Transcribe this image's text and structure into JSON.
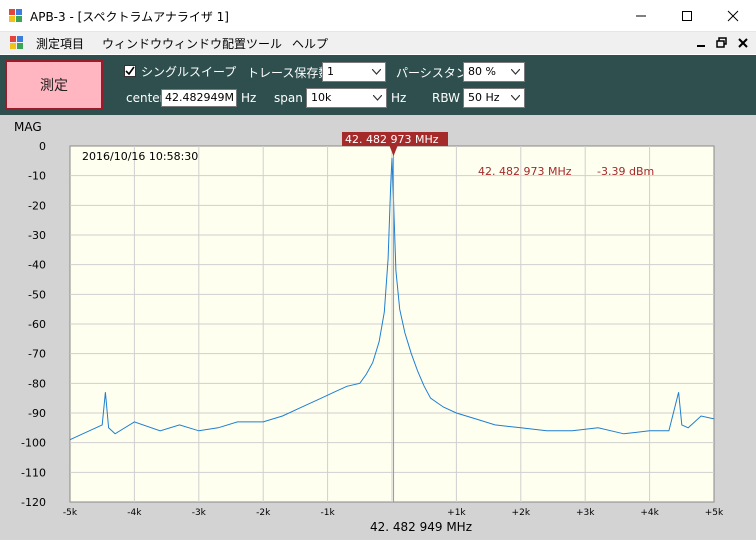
{
  "window": {
    "title": "APB-3 - [スペクトラムアナライザ 1]"
  },
  "menu": {
    "items": [
      "測定項目",
      "ウィンドウ",
      "ウィンドウ配置",
      "ツール",
      "ヘルプ"
    ]
  },
  "toolbar": {
    "measure_label": "測定",
    "single_sweep_label": "シングルスイープ",
    "single_sweep_checked": true,
    "trace_save_label": "トレース保存数",
    "trace_save_value": "1",
    "persistence_label": "パーシスタンス",
    "persistence_value": "80 %",
    "center_label": "center",
    "center_value": "42.482949M",
    "center_unit": "Hz",
    "span_label": "span",
    "span_value": "10k",
    "span_unit": "Hz",
    "rbw_label": "RBW",
    "rbw_value": "50 Hz"
  },
  "plot": {
    "mag_label": "MAG",
    "timestamp": "2016/10/16 10:58:30",
    "marker_label": "42. 482 973 MHz",
    "marker_freq_readout": "42. 482 973 MHz",
    "marker_level_readout": "-3.39 dBm",
    "center_freq_label": "42. 482 949 MHz",
    "background_color": "#fffff0",
    "trace_color": "#1e7fd0",
    "marker_color": "#a52a2a"
  },
  "chart_data": {
    "type": "line",
    "x_ticks": [
      "-5k",
      "-4k",
      "-3k",
      "-2k",
      "-1k",
      "0",
      "+1k",
      "+2k",
      "+3k",
      "+4k",
      "+5k"
    ],
    "y_ticks": [
      "0",
      "-10",
      "-20",
      "-30",
      "-40",
      "-50",
      "-60",
      "-70",
      "-80",
      "-90",
      "-100",
      "-110",
      "-120"
    ],
    "xlim": [
      -5000,
      5000
    ],
    "ylim": [
      -120,
      0
    ],
    "grid": true,
    "series": [
      {
        "x": [
          -5000,
          -4700,
          -4500,
          -4450,
          -4400,
          -4300,
          -4000,
          -3600,
          -3300,
          -3000,
          -2700,
          -2400,
          -2000,
          -1700,
          -1400,
          -1100,
          -900,
          -700,
          -500,
          -400,
          -300,
          -200,
          -120,
          -60,
          -20,
          0,
          20,
          60,
          120,
          200,
          300,
          400,
          500,
          600,
          800,
          1000,
          1300,
          1600,
          2000,
          2400,
          2800,
          3200,
          3600,
          4000,
          4300,
          4450,
          4500,
          4600,
          4800,
          5000
        ],
        "y": [
          -99,
          -96,
          -94,
          -83,
          -95,
          -97,
          -93,
          -96,
          -94,
          -96,
          -95,
          -93,
          -93,
          -91,
          -88,
          -85,
          -83,
          -81,
          -80,
          -77,
          -73,
          -66,
          -56,
          -38,
          -13,
          -4,
          -16,
          -42,
          -55,
          -63,
          -70,
          -76,
          -81,
          -85,
          -88,
          -90,
          -92,
          -94,
          -95,
          -96,
          -96,
          -95,
          -97,
          -96,
          -96,
          -83,
          -94,
          -95,
          -91,
          -92
        ]
      }
    ],
    "marker": {
      "x": 24,
      "y": -3.39
    }
  }
}
